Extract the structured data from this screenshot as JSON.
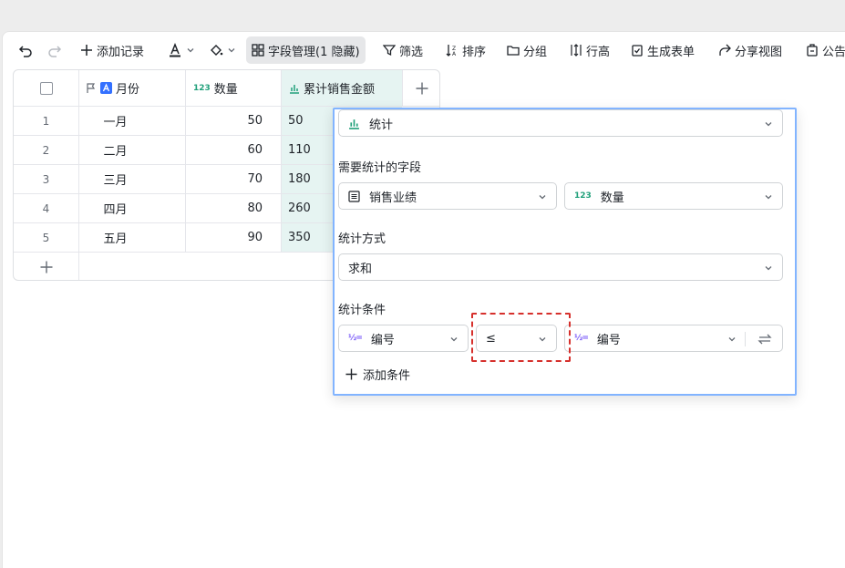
{
  "toolbar": {
    "add_record": "添加记录",
    "field_manage": "字段管理(1 隐藏)",
    "filter": "筛选",
    "sort": "排序",
    "group": "分组",
    "row_height": "行高",
    "form": "生成表单",
    "share_view": "分享视图",
    "notice": "公告"
  },
  "grid": {
    "columns": [
      {
        "label": "月份",
        "icon": "flag-icon"
      },
      {
        "label": "数量",
        "icon": "number-icon"
      },
      {
        "label": "累计销售金额",
        "icon": "stats-icon"
      }
    ],
    "rows": [
      {
        "num": "1",
        "month": "一月",
        "qty": "50",
        "cum": "50"
      },
      {
        "num": "2",
        "month": "二月",
        "qty": "60",
        "cum": "110"
      },
      {
        "num": "3",
        "month": "三月",
        "qty": "70",
        "cum": "180"
      },
      {
        "num": "4",
        "month": "四月",
        "qty": "80",
        "cum": "260"
      },
      {
        "num": "5",
        "month": "五月",
        "qty": "90",
        "cum": "350"
      }
    ]
  },
  "popup": {
    "type_value": "统计",
    "field_label": "需要统计的字段",
    "table_value": "销售业绩",
    "field_value": "数量",
    "method_label": "统计方式",
    "method_value": "求和",
    "condition_label": "统计条件",
    "cond_left": "编号",
    "cond_op": "≤",
    "cond_right": "编号",
    "add_condition": "添加条件"
  },
  "colors": {
    "accent": "#3370ff",
    "highlight_col": "#e6f4f2",
    "popup_border": "#82b4ff",
    "red_annotation": "#d6302c"
  }
}
